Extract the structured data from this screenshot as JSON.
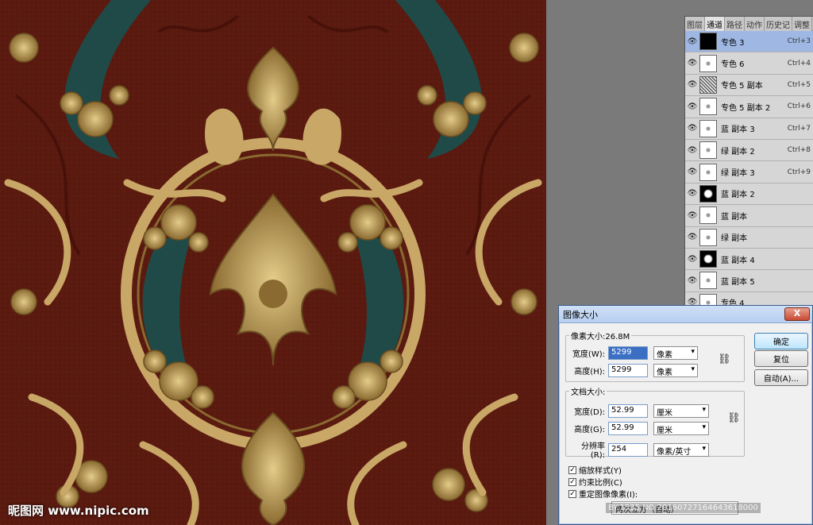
{
  "canvas": {
    "background_color": "#5a1a10",
    "ornament_gold": "#c9a766",
    "ornament_teal": "#1f4a48"
  },
  "channels_panel": {
    "tabs": [
      "图层",
      "通道",
      "路径",
      "动作",
      "历史记",
      "调整"
    ],
    "active_tab": "通道",
    "rows": [
      {
        "name": "专色 3",
        "shortcut": "Ctrl+3",
        "thumb": "black",
        "selected": true
      },
      {
        "name": "专色 6",
        "shortcut": "Ctrl+4",
        "thumb": "sparse"
      },
      {
        "name": "专色 5 副本",
        "shortcut": "Ctrl+5",
        "thumb": "noise"
      },
      {
        "name": "专色 5 副本 2",
        "shortcut": "Ctrl+6",
        "thumb": "sparse"
      },
      {
        "name": "蓝 副本 3",
        "shortcut": "Ctrl+7",
        "thumb": "sparse"
      },
      {
        "name": "绿 副本 2",
        "shortcut": "Ctrl+8",
        "thumb": "sparse"
      },
      {
        "name": "绿 副本 3",
        "shortcut": "Ctrl+9",
        "thumb": "sparse"
      },
      {
        "name": "蓝 副本 2",
        "shortcut": "",
        "thumb": "dark"
      },
      {
        "name": "蓝 副本",
        "shortcut": "",
        "thumb": "sparse"
      },
      {
        "name": "绿 副本",
        "shortcut": "",
        "thumb": "sparse"
      },
      {
        "name": "蓝 副本 4",
        "shortcut": "",
        "thumb": "dark"
      },
      {
        "name": "蓝 副本 5",
        "shortcut": "",
        "thumb": "sparse"
      },
      {
        "name": "专色 4",
        "shortcut": "",
        "thumb": "sparse"
      }
    ]
  },
  "dialog": {
    "title": "图像大小",
    "close_label": "X",
    "pixel_group_label": "像素大小:26.8M",
    "pixel_width_label": "宽度(W):",
    "pixel_width_value": "5299",
    "pixel_width_unit": "像素",
    "pixel_height_label": "高度(H):",
    "pixel_height_value": "5299",
    "pixel_height_unit": "像素",
    "doc_group_label": "文档大小:",
    "doc_width_label": "宽度(D):",
    "doc_width_value": "52.99",
    "doc_width_unit": "厘米",
    "doc_height_label": "高度(G):",
    "doc_height_value": "52.99",
    "doc_height_unit": "厘米",
    "resolution_label": "分辨率(R):",
    "resolution_value": "254",
    "resolution_unit": "像素/英寸",
    "scale_styles_label": "缩放样式(Y)",
    "constrain_label": "约束比例(C)",
    "resample_label": "重定图像像素(I):",
    "resample_value": "两次立方（自动）",
    "ok_label": "确定",
    "reset_label": "复位",
    "auto_label": "自动(A)..."
  },
  "watermark": {
    "site": "昵图网 www.nipic.com",
    "stamp": "BY:1535 NO:20160727164643618000"
  }
}
